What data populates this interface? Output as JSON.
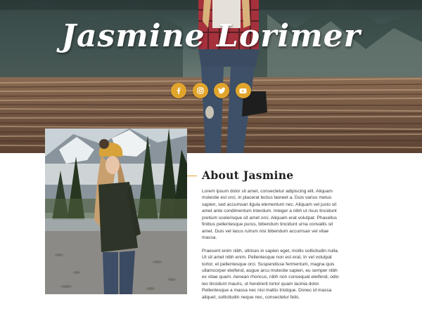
{
  "hero": {
    "title": "Jasmine Lorimer",
    "social": [
      {
        "name": "facebook",
        "icon": "facebook-icon"
      },
      {
        "name": "instagram",
        "icon": "instagram-icon"
      },
      {
        "name": "twitter",
        "icon": "twitter-icon"
      },
      {
        "name": "youtube",
        "icon": "youtube-icon"
      }
    ]
  },
  "about": {
    "heading": "About Jasmine",
    "paragraphs": [
      "Lorem ipsum dolor sit amet, consectetur adipiscing elit. Aliquam molestie est orci, in placerat lectus laoreet a. Duis varius metus sapien, sed accumsan ligula elementum nec. Aliquam vel justo sit amet ante condimentum interdum. Integer a nibh ut risus tincidunt pretium scelerisque sit amet orci. Aliquam erat volutpat. Phasellus finibus pellentesque purus, bibendum tincidunt urna convallis sit amet. Duis vel lacus rutrum nisi bibendum accumsan vel vitae massa.",
      "Praesent enim nibh, ultrices in sapien eget, mollis sollicitudin nulla. Ut sit amet nibh enim. Pellentesque non est erat. In vel volutpat tortor, et pellentesque orci. Suspendisse fermentum, magna quis ullamcorper eleifend, augue arcu molestie sapien, eu semper nibh ex vitae quam. Aenean rhoncus, nibh non consequat eleifend, odio leo tincidunt mauris, ut hendrerit tortor quam lacinia dolor. Pellentesque a massa nec nisi mattis tristique. Donec id massa aliquet, sollicitudin neque nec, consectetur felis."
    ]
  },
  "colors": {
    "accent": "#e1a52c",
    "heading": "#222222",
    "body_text": "#3a3a3a",
    "background": "#ffffff"
  }
}
